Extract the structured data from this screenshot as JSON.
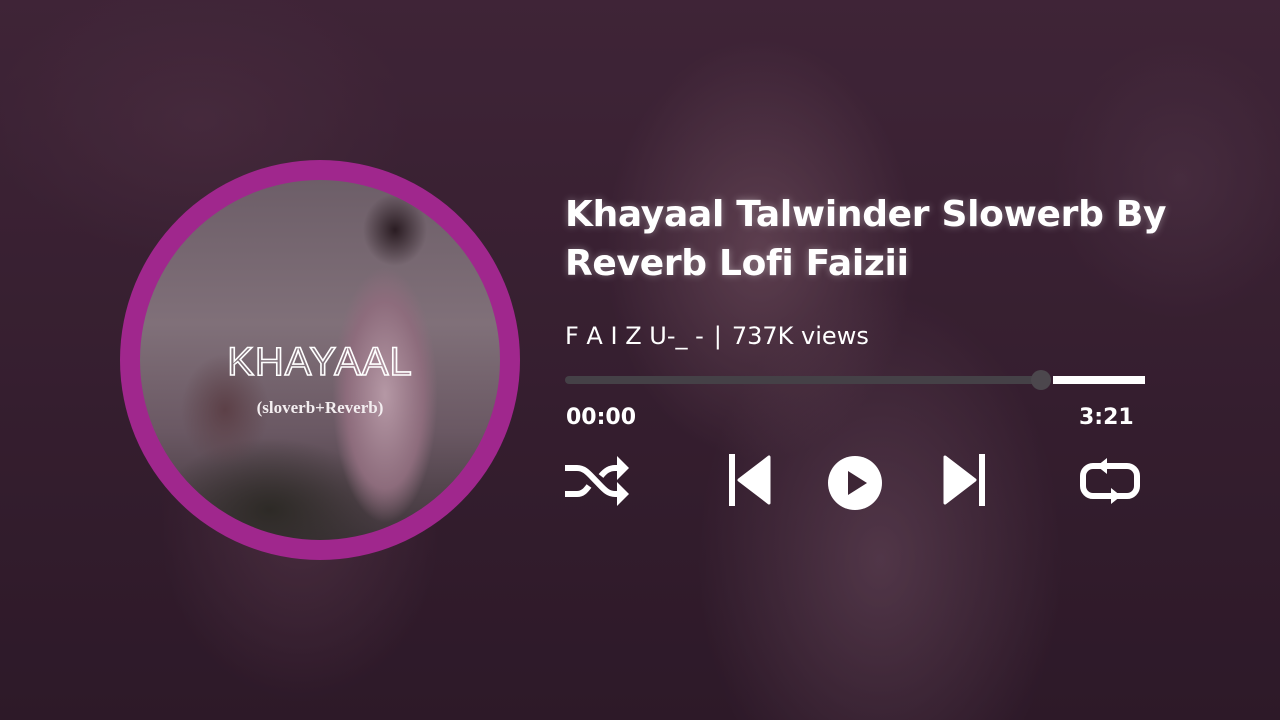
{
  "track": {
    "title": "Khayaal Talwinder Slowerb By Reverb Lofi Faizii",
    "artist": "F A I Z U-_ -",
    "separator": "|",
    "views": "737K views"
  },
  "artwork": {
    "title": "KHAYAAL",
    "subtitle": "(sloverb+Reverb)",
    "ring_color": "#a0278d"
  },
  "playback": {
    "current_time": "00:00",
    "total_time": "3:21",
    "progress_fraction": 0.82
  },
  "controls": {
    "shuffle_icon": "shuffle-icon",
    "previous_icon": "skip-previous-icon",
    "play_icon": "play-icon",
    "next_icon": "skip-next-icon",
    "repeat_icon": "repeat-icon"
  },
  "colors": {
    "accent": "#a0278d",
    "text": "#ffffff",
    "track_played": "#454147"
  }
}
